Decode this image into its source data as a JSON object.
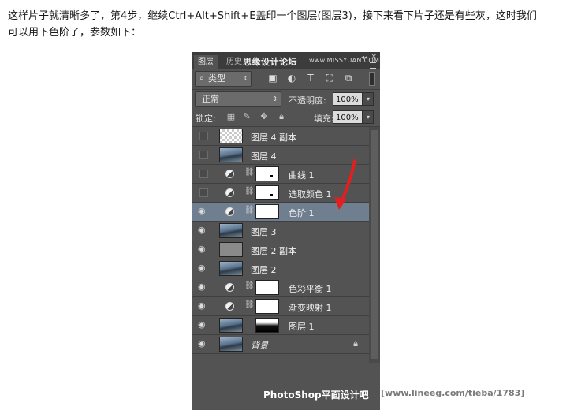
{
  "caption": {
    "line1": "这样片子就清晰多了，第4步，继续Ctrl+Alt+Shift+E盖印一个图层(图层3)，接下来看下片子还是有些灰，这时我们",
    "line2": "可以用下色阶了，参数如下："
  },
  "panel": {
    "tabs": [
      "图层",
      "历史"
    ],
    "watermark": "思缘设计论坛",
    "site": "www.MISSYUAN.COM",
    "kind_filter": "类型",
    "filter_icons": [
      "image-filter-icon",
      "adjustment-filter-icon",
      "type-filter-icon",
      "shape-filter-icon",
      "smartobject-filter-icon"
    ],
    "blend_mode": "正常",
    "opacity_label": "不透明度:",
    "opacity": "100%",
    "lock_label": "锁定:",
    "fill_label": "填充:",
    "fill": "100%",
    "layers": [
      {
        "name": "图层 4 副本",
        "visible": false,
        "type": "transparent"
      },
      {
        "name": "图层 4",
        "visible": false,
        "type": "photo"
      },
      {
        "name": "曲线 1",
        "visible": false,
        "type": "adjustment"
      },
      {
        "name": "选取颜色 1",
        "visible": false,
        "type": "adjustment"
      },
      {
        "name": "色阶 1",
        "visible": true,
        "type": "adjustment",
        "selected": true
      },
      {
        "name": "图层 3",
        "visible": true,
        "type": "photo"
      },
      {
        "name": "图层 2 副本",
        "visible": true,
        "type": "gray"
      },
      {
        "name": "图层 2",
        "visible": true,
        "type": "photo"
      },
      {
        "name": "色彩平衡 1",
        "visible": true,
        "type": "adjustment"
      },
      {
        "name": "渐变映射 1",
        "visible": true,
        "type": "adjustment"
      },
      {
        "name": "图层 1",
        "visible": true,
        "type": "photo-mask"
      },
      {
        "name": "背景",
        "visible": true,
        "type": "background",
        "locked": true
      }
    ],
    "footer_watermark": "PhotoShop平面设计吧",
    "footer_url": "[www.lineeg.com/tieba/1783]"
  },
  "colors": {
    "panel_bg": "#535353",
    "selected_row": "#6f7f8f",
    "arrow": "#e02020"
  }
}
